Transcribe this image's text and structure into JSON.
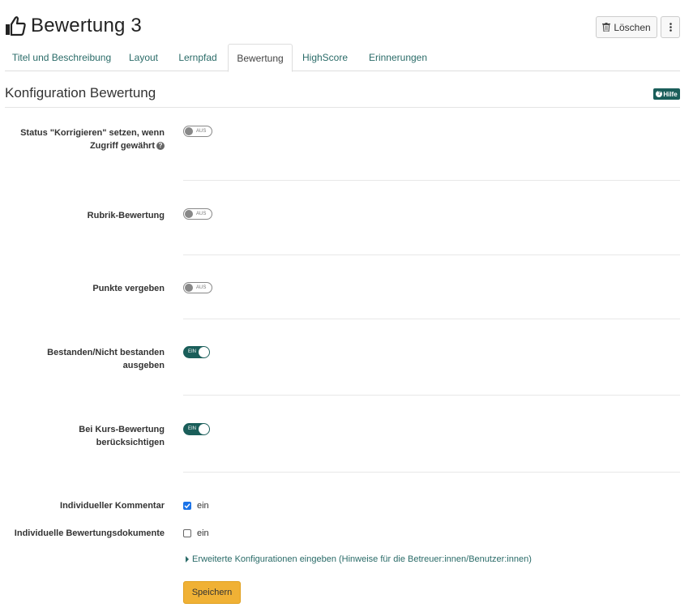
{
  "header": {
    "title": "Bewertung 3",
    "icon": "thumbs-up-icon"
  },
  "toolbar": {
    "delete_label": "Löschen",
    "more_icon": "vertical-ellipsis-icon"
  },
  "tabs": [
    {
      "label": "Titel und Beschreibung",
      "active": false
    },
    {
      "label": "Layout",
      "active": false
    },
    {
      "label": "Lernpfad",
      "active": false
    },
    {
      "label": "Bewertung",
      "active": true
    },
    {
      "label": "HighScore",
      "active": false
    },
    {
      "label": "Erinnerungen",
      "active": false
    }
  ],
  "section": {
    "title": "Konfiguration Bewertung",
    "help_label": "Hilfe"
  },
  "settings": {
    "status_korrigieren": {
      "label_line1": "Status \"Korrigieren\" setzen, wenn",
      "label_line2": "Zugriff gewährt",
      "state": "AUS"
    },
    "rubrik": {
      "label": "Rubrik-Bewertung",
      "state": "AUS"
    },
    "punkte": {
      "label": "Punkte vergeben",
      "state": "AUS"
    },
    "bestanden": {
      "label_line1": "Bestanden/Nicht bestanden",
      "label_line2": "ausgeben",
      "state": "EIN"
    },
    "kurs": {
      "label_line1": "Bei Kurs-Bewertung",
      "label_line2": "berücksichtigen",
      "state": "EIN"
    },
    "kommentar": {
      "label": "Individueller Kommentar",
      "option": "ein",
      "checked": true
    },
    "dokumente": {
      "label": "Individuelle Bewertungsdokumente",
      "option": "ein",
      "checked": false
    }
  },
  "advanced_link": "Erweiterte Konfigurationen eingeben (Hinweise für die Betreuer:innen/Benutzer:innen)",
  "save_label": "Speichern",
  "colors": {
    "accent": "#1a5e5a",
    "link": "#2a6b68",
    "save": "#f0b135",
    "checkbox": "#1a73e8"
  }
}
